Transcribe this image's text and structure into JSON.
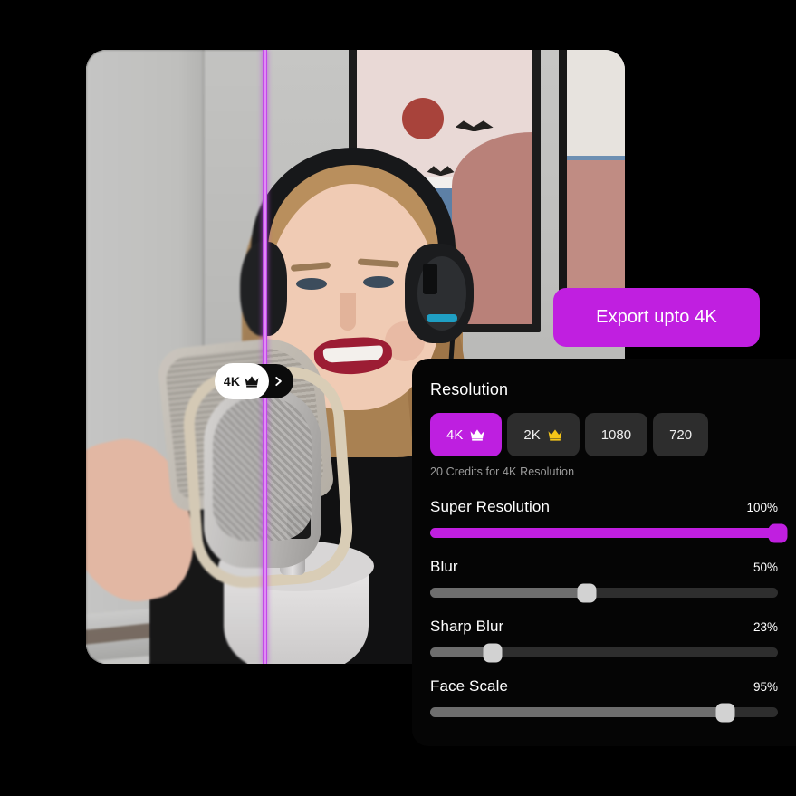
{
  "photo": {
    "alt_description": "Woman wearing over-ear headphones speaking into a condenser microphone",
    "comparison_divider_color": "#c24ae8"
  },
  "badge": {
    "label": "4K",
    "crown_icon": "crown-icon",
    "chevron_icon": "chevron-right-icon"
  },
  "tooltip": {
    "text": "Export upto 4K",
    "color": "#c01fe0"
  },
  "panel": {
    "resolution": {
      "title": "Resolution",
      "options": [
        {
          "label": "4K",
          "crown": true,
          "crown_color": "#ffffff",
          "selected": true
        },
        {
          "label": "2K",
          "crown": true,
          "crown_color": "#f5c518",
          "selected": false
        },
        {
          "label": "1080",
          "crown": false,
          "crown_color": "",
          "selected": false
        },
        {
          "label": "720",
          "crown": false,
          "crown_color": "",
          "selected": false
        }
      ],
      "credits_note": "20 Credits for 4K Resolution",
      "accent_color": "#be1fe0"
    },
    "sliders": [
      {
        "label": "Super Resolution",
        "value": "100%",
        "percent": 100,
        "style": "purple"
      },
      {
        "label": "Blur",
        "value": "50%",
        "percent": 45,
        "style": "gray"
      },
      {
        "label": "Sharp Blur",
        "value": "23%",
        "percent": 18,
        "style": "gray"
      },
      {
        "label": "Face Scale",
        "value": "95%",
        "percent": 85,
        "style": "gray"
      }
    ]
  }
}
